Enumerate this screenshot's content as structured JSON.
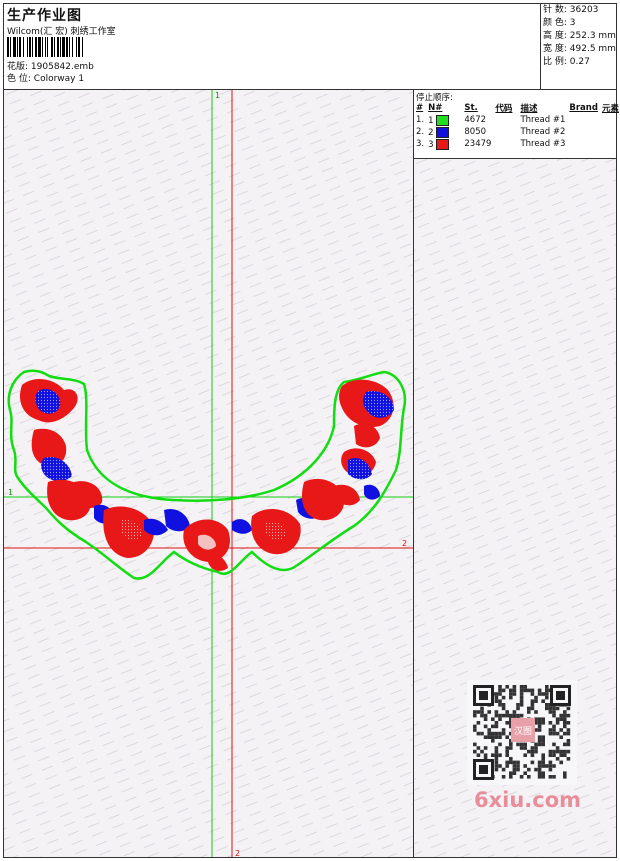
{
  "header": {
    "title": "生产作业图",
    "company": "Wilcom(汇 宏) 刺绣工作室",
    "pattern_label": "花版:",
    "pattern_value": "1905842.emb",
    "colorway_label": "色 位:",
    "colorway_value": "Colorway 1"
  },
  "stats": [
    {
      "label": "针 数:",
      "value": "36203"
    },
    {
      "label": "颜 色:",
      "value": "3"
    },
    {
      "label": "高 度:",
      "value": "252.3 mm"
    },
    {
      "label": "宽 度:",
      "value": "492.5 mm"
    },
    {
      "label": "比 例:",
      "value": "0.27"
    }
  ],
  "stop_sequence": {
    "caption": "停止顺序:",
    "columns": [
      "#",
      "N#",
      "St.",
      "代码",
      "描述",
      "Brand",
      "元素"
    ],
    "rows": [
      {
        "num": "1.",
        "n": "1",
        "color": "#22dd22",
        "code": "4672",
        "desc": "Thread #1"
      },
      {
        "num": "2.",
        "n": "2",
        "color": "#1010e0",
        "code": "8050",
        "desc": "Thread #2"
      },
      {
        "num": "3.",
        "n": "3",
        "color": "#e81818",
        "code": "23479",
        "desc": "Thread #3"
      }
    ]
  },
  "guides": {
    "v1": "1",
    "h1": "1",
    "h2": "2",
    "v2": "2"
  },
  "watermark": {
    "logo": "6xiu.com",
    "seal": "汉图"
  }
}
